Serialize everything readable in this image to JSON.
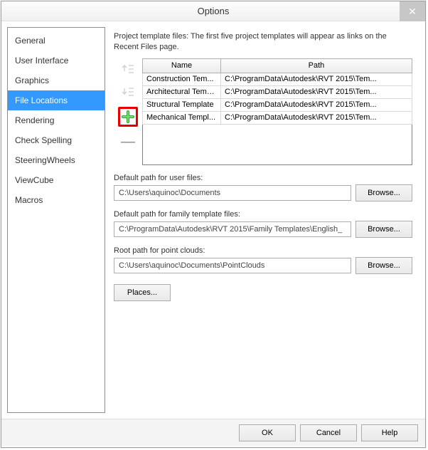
{
  "window": {
    "title": "Options"
  },
  "sidebar": {
    "items": [
      {
        "label": "General"
      },
      {
        "label": "User Interface"
      },
      {
        "label": "Graphics"
      },
      {
        "label": "File Locations"
      },
      {
        "label": "Rendering"
      },
      {
        "label": "Check Spelling"
      },
      {
        "label": "SteeringWheels"
      },
      {
        "label": "ViewCube"
      },
      {
        "label": "Macros"
      }
    ],
    "activeIndex": 3
  },
  "main": {
    "description": "Project template files:  The first five project templates will appear as links on the Recent Files page.",
    "table": {
      "headers": {
        "name": "Name",
        "path": "Path"
      },
      "rows": [
        {
          "name": "Construction Tem...",
          "path": "C:\\ProgramData\\Autodesk\\RVT 2015\\Tem..."
        },
        {
          "name": "Architectural Temp...",
          "path": "C:\\ProgramData\\Autodesk\\RVT 2015\\Tem..."
        },
        {
          "name": "Structural Template",
          "path": "C:\\ProgramData\\Autodesk\\RVT 2015\\Tem..."
        },
        {
          "name": "Mechanical Templ...",
          "path": "C:\\ProgramData\\Autodesk\\RVT 2015\\Tem..."
        }
      ]
    },
    "fields": {
      "userFiles": {
        "label": "Default path for user files:",
        "value": "C:\\Users\\aquinoc\\Documents",
        "btn": "Browse..."
      },
      "familyTemplates": {
        "label": "Default path for family template files:",
        "value": "C:\\ProgramData\\Autodesk\\RVT 2015\\Family Templates\\English_",
        "btn": "Browse..."
      },
      "pointClouds": {
        "label": "Root path for point clouds:",
        "value": "C:\\Users\\aquinoc\\Documents\\PointClouds",
        "btn": "Browse..."
      }
    },
    "placesBtn": "Places..."
  },
  "footer": {
    "ok": "OK",
    "cancel": "Cancel",
    "help": "Help"
  }
}
